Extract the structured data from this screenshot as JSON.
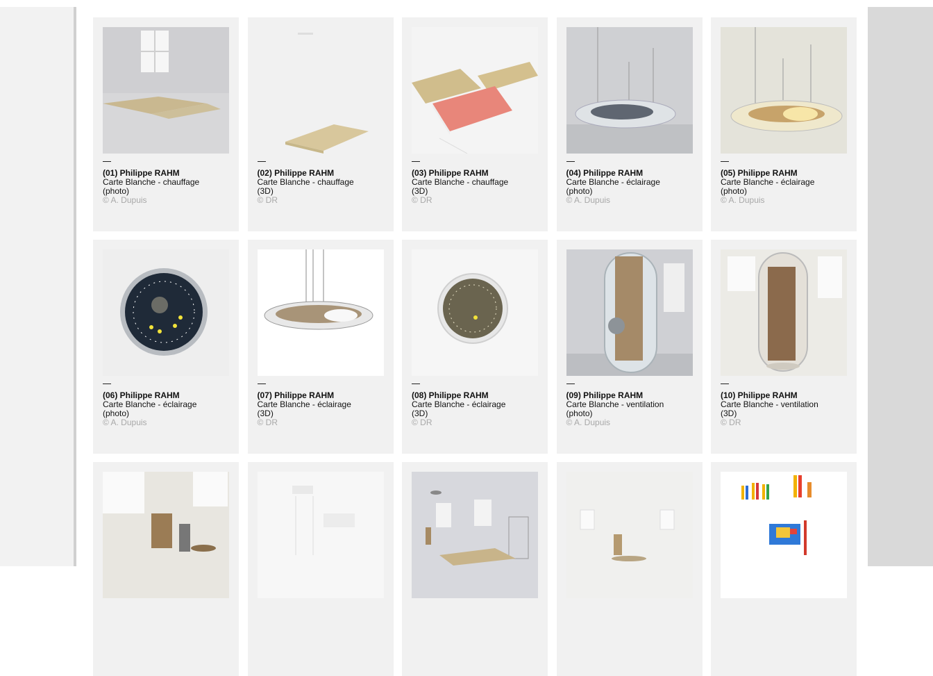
{
  "gallery": {
    "items": [
      {
        "title": "(01) Philippe RAHM",
        "desc": "Carte Blanche - chauffage",
        "kind": "(photo)",
        "credit": "© A. Dupuis",
        "icon": "room-mats-photo"
      },
      {
        "title": "(02) Philippe RAHM",
        "desc": "Carte Blanche - chauffage",
        "kind": "(3D)",
        "credit": "© DR",
        "icon": "room-mats-render"
      },
      {
        "title": "(03) Philippe RAHM",
        "desc": "Carte Blanche - chauffage",
        "kind": "(3D)",
        "credit": "© DR",
        "icon": "heating-mats-red"
      },
      {
        "title": "(04) Philippe RAHM",
        "desc": "Carte Blanche - éclairage",
        "kind": "(photo)",
        "credit": "© A. Dupuis",
        "icon": "suspended-disc-lamp"
      },
      {
        "title": "(05) Philippe RAHM",
        "desc": "Carte Blanche - éclairage",
        "kind": "(photo)",
        "credit": "© A. Dupuis",
        "icon": "suspended-disc-lamp-lit"
      },
      {
        "title": "(06) Philippe RAHM",
        "desc": "Carte Blanche - éclairage",
        "kind": "(photo)",
        "credit": "© A. Dupuis",
        "icon": "round-dial"
      },
      {
        "title": "(07) Philippe RAHM",
        "desc": "Carte Blanche - éclairage",
        "kind": "(3D)",
        "credit": "© DR",
        "icon": "hanging-oval-lamp"
      },
      {
        "title": "(08) Philippe RAHM",
        "desc": "Carte Blanche - éclairage",
        "kind": "(3D)",
        "credit": "© DR",
        "icon": "round-dial-render"
      },
      {
        "title": "(09) Philippe RAHM",
        "desc": "Carte Blanche - ventilation",
        "kind": "(photo)",
        "credit": "© A. Dupuis",
        "icon": "glass-capsule"
      },
      {
        "title": "(10) Philippe RAHM",
        "desc": "Carte Blanche - ventilation",
        "kind": "(3D)",
        "credit": "© DR",
        "icon": "glass-capsule-render"
      },
      {
        "title": "",
        "desc": "",
        "kind": "",
        "credit": "",
        "icon": "room-objects"
      },
      {
        "title": "",
        "desc": "",
        "kind": "",
        "credit": "",
        "icon": "white-furniture"
      },
      {
        "title": "",
        "desc": "",
        "kind": "",
        "credit": "",
        "icon": "room-installation"
      },
      {
        "title": "",
        "desc": "",
        "kind": "",
        "credit": "",
        "icon": "bright-room"
      },
      {
        "title": "",
        "desc": "",
        "kind": "",
        "credit": "",
        "icon": "diagram-chart"
      }
    ]
  }
}
